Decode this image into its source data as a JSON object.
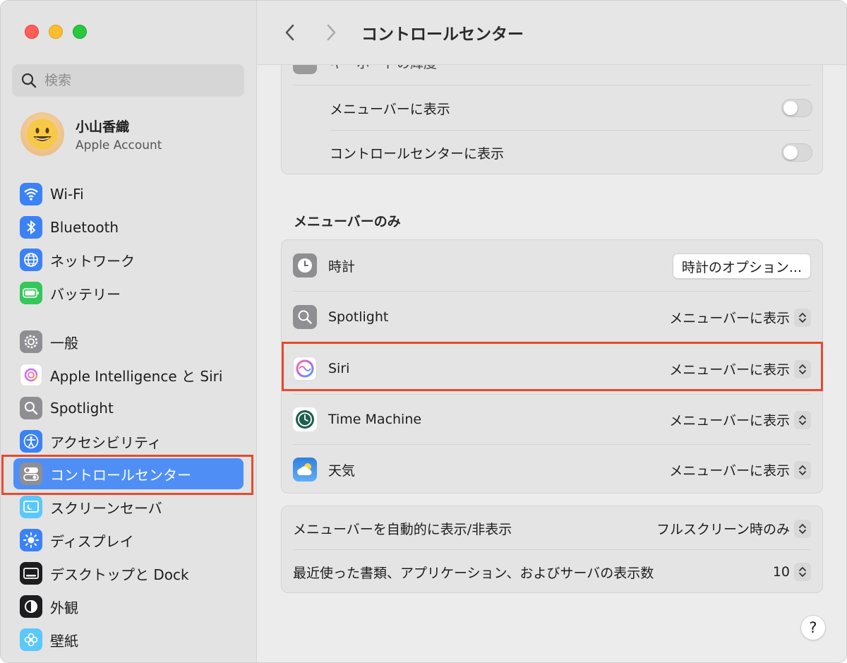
{
  "window": {
    "traffic_lights": [
      "close",
      "minimize",
      "zoom"
    ]
  },
  "sidebar": {
    "search_placeholder": "検索",
    "account": {
      "name": "小山香織",
      "subtitle": "Apple Account",
      "avatar_icon": "smiley-emoji"
    },
    "items": [
      {
        "label": "Wi-Fi",
        "icon": "wifi-icon",
        "color": "#3b82f6"
      },
      {
        "label": "Bluetooth",
        "icon": "bluetooth-icon",
        "color": "#3b82f6"
      },
      {
        "label": "ネットワーク",
        "icon": "globe-icon",
        "color": "#3b82f6"
      },
      {
        "label": "バッテリー",
        "icon": "battery-icon",
        "color": "#34c759"
      },
      {
        "label": "一般",
        "icon": "gear-icon",
        "color": "#8e8e93"
      },
      {
        "label": "Apple Intelligence と Siri",
        "icon": "apple-intelligence-icon",
        "color": "#e0a0f0"
      },
      {
        "label": "Spotlight",
        "icon": "magnifier-icon",
        "color": "#8e8e93"
      },
      {
        "label": "アクセシビリティ",
        "icon": "accessibility-icon",
        "color": "#3b82f6"
      },
      {
        "label": "コントロールセンター",
        "icon": "control-center-icon",
        "color": "#8e8e93",
        "selected": true
      },
      {
        "label": "スクリーンセーバ",
        "icon": "screensaver-icon",
        "color": "#5ac8fa"
      },
      {
        "label": "ディスプレイ",
        "icon": "display-brightness-icon",
        "color": "#3b82f6"
      },
      {
        "label": "デスクトップと Dock",
        "icon": "dock-icon",
        "color": "#1d1d1f"
      },
      {
        "label": "外観",
        "icon": "appearance-icon",
        "color": "#1d1d1f"
      },
      {
        "label": "壁紙",
        "icon": "wallpaper-icon",
        "color": "#5ac8fa"
      }
    ]
  },
  "main": {
    "title": "コントロールセンター",
    "top_group": {
      "partial_label": "キーボードの輝度",
      "rows": [
        {
          "label": "メニューバーに表示",
          "toggle": false
        },
        {
          "label": "コントロールセンターに表示",
          "toggle": false
        }
      ]
    },
    "menubar_only": {
      "section_title": "メニューバーのみ",
      "rows": [
        {
          "label": "時計",
          "icon": "clock-icon",
          "button": "時計のオプション..."
        },
        {
          "label": "Spotlight",
          "icon": "spotlight-icon",
          "value": "メニューバーに表示"
        },
        {
          "label": "Siri",
          "icon": "siri-icon",
          "value": "メニューバーに表示",
          "highlighted": true
        },
        {
          "label": "Time Machine",
          "icon": "time-machine-icon",
          "value": "メニューバーに表示"
        },
        {
          "label": "天気",
          "icon": "weather-icon",
          "value": "メニューバーに表示"
        }
      ]
    },
    "bottom_group": {
      "rows": [
        {
          "label": "メニューバーを自動的に表示/非表示",
          "value": "フルスクリーン時のみ"
        },
        {
          "label": "最近使った書類、アプリケーション、およびサーバの表示数",
          "value": "10"
        }
      ]
    },
    "help_label": "?"
  },
  "colors": {
    "accent": "#4f8ff5",
    "highlight": "#e64a2e"
  }
}
